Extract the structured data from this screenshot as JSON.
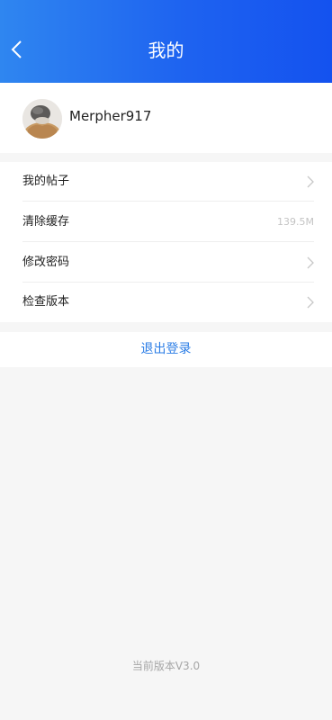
{
  "header": {
    "title": "我的",
    "back_icon": "chevron-left-icon",
    "colors": {
      "gradient_start": "#2f86f0",
      "gradient_end": "#1452ef"
    }
  },
  "profile": {
    "username": "Merpher917"
  },
  "menu": {
    "items": [
      {
        "label": "我的帖子",
        "trailing": "chevron-right-icon"
      },
      {
        "label": "清除缓存",
        "value": "139.5M"
      },
      {
        "label": "修改密码",
        "trailing": "chevron-right-icon"
      },
      {
        "label": "检查版本",
        "trailing": "chevron-right-icon"
      }
    ]
  },
  "logout": {
    "label": "退出登录",
    "color": "#2b7de6"
  },
  "footer": {
    "version_text": "当前版本V3.0"
  }
}
